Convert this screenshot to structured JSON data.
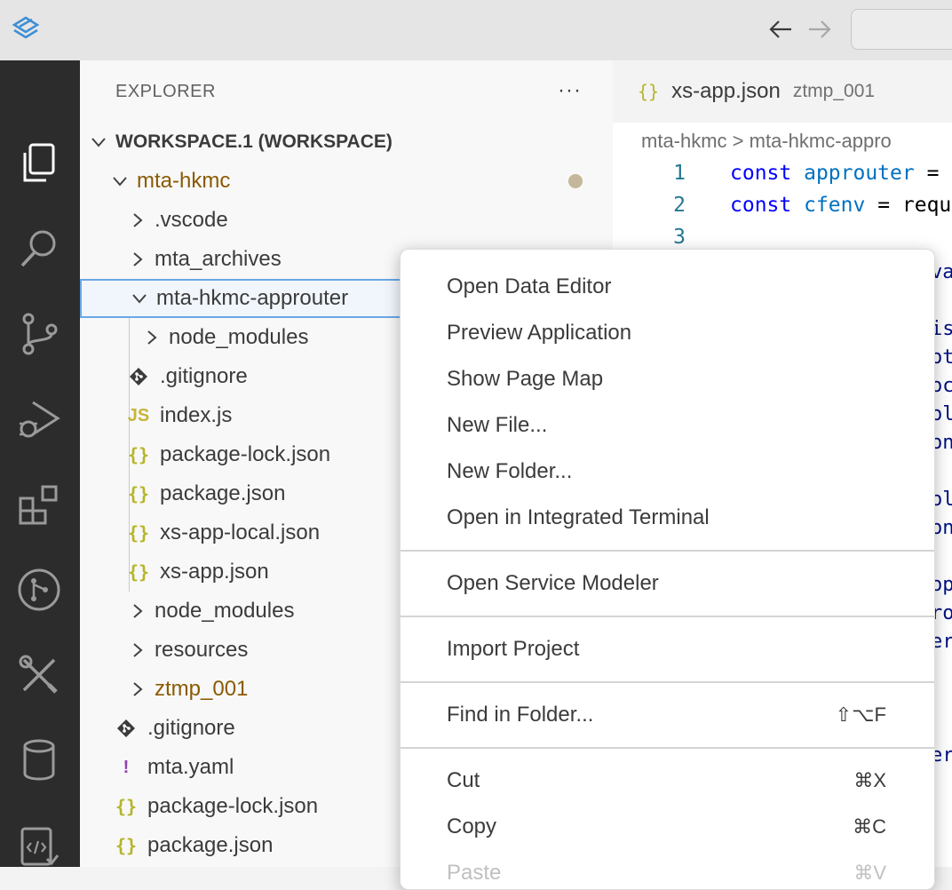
{
  "titlebar": {
    "back_label": "←",
    "forward_label": "→"
  },
  "activity_icons": [
    "explorer-icon",
    "search-icon",
    "source-control-icon",
    "run-debug-icon",
    "extensions-icon",
    "git-graph-icon",
    "tools-icon",
    "database-icon",
    "code-page-icon"
  ],
  "sidebar": {
    "title": "EXPLORER",
    "more": "···",
    "tree": [
      {
        "label": "WORKSPACE.1 (WORKSPACE)",
        "icon": "",
        "chevron": "down"
      },
      {
        "label": "mta-hkmc",
        "icon": "",
        "chevron": "down"
      },
      {
        "label": ".vscode",
        "icon": "",
        "chevron": "right"
      },
      {
        "label": "mta_archives",
        "icon": "",
        "chevron": "right"
      },
      {
        "label": "mta-hkmc-approuter",
        "icon": "",
        "chevron": "down"
      },
      {
        "label": "node_modules",
        "icon": "",
        "chevron": "right"
      },
      {
        "label": ".gitignore",
        "icon": "git",
        "chevron": ""
      },
      {
        "label": "index.js",
        "icon": "JS",
        "chevron": ""
      },
      {
        "label": "package-lock.json",
        "icon": "{}",
        "chevron": ""
      },
      {
        "label": "package.json",
        "icon": "{}",
        "chevron": ""
      },
      {
        "label": "xs-app-local.json",
        "icon": "{}",
        "chevron": ""
      },
      {
        "label": "xs-app.json",
        "icon": "{}",
        "chevron": ""
      },
      {
        "label": "node_modules",
        "icon": "",
        "chevron": "right"
      },
      {
        "label": "resources",
        "icon": "",
        "chevron": "right"
      },
      {
        "label": "ztmp_001",
        "icon": "",
        "chevron": "right"
      },
      {
        "label": ".gitignore",
        "icon": "git",
        "chevron": ""
      },
      {
        "label": "mta.yaml",
        "icon": "!",
        "chevron": ""
      },
      {
        "label": "package-lock.json",
        "icon": "{}",
        "chevron": ""
      },
      {
        "label": "package.json",
        "icon": "{}",
        "chevron": ""
      }
    ]
  },
  "editor": {
    "tab": {
      "icon": "{}",
      "name": "xs-app.json",
      "description": "ztmp_001"
    },
    "breadcrumb": "mta-hkmc > mta-hkmc-appro",
    "lines": [
      {
        "num": "1",
        "kw": "const",
        "var": "approuter",
        "rest": " ="
      },
      {
        "num": "2",
        "kw": "const",
        "var": "cfenv",
        "rest": " = requ"
      },
      {
        "num": "3",
        "kw": "",
        "var": "",
        "rest": ""
      }
    ],
    "peek": [
      "va",
      "",
      "is",
      "oti",
      "oca",
      "ol",
      "on",
      "",
      "ol",
      "on",
      "",
      "opt",
      "ro",
      "erl",
      "",
      "",
      "",
      "er"
    ]
  },
  "context_menu": {
    "items": [
      {
        "label": "Open Data Editor",
        "shortcut": ""
      },
      {
        "label": "Preview Application",
        "shortcut": ""
      },
      {
        "label": "Show Page Map",
        "shortcut": ""
      },
      {
        "label": "New File...",
        "shortcut": ""
      },
      {
        "label": "New Folder...",
        "shortcut": ""
      },
      {
        "label": "Open in Integrated Terminal",
        "shortcut": ""
      },
      {
        "label": "Open Service Modeler",
        "shortcut": ""
      },
      {
        "label": "Import Project",
        "shortcut": ""
      },
      {
        "label": "Find in Folder...",
        "shortcut": "⇧⌥F"
      },
      {
        "label": "Cut",
        "shortcut": "⌘X"
      },
      {
        "label": "Copy",
        "shortcut": "⌘C"
      },
      {
        "label": "Paste",
        "shortcut": "⌘V"
      }
    ]
  }
}
